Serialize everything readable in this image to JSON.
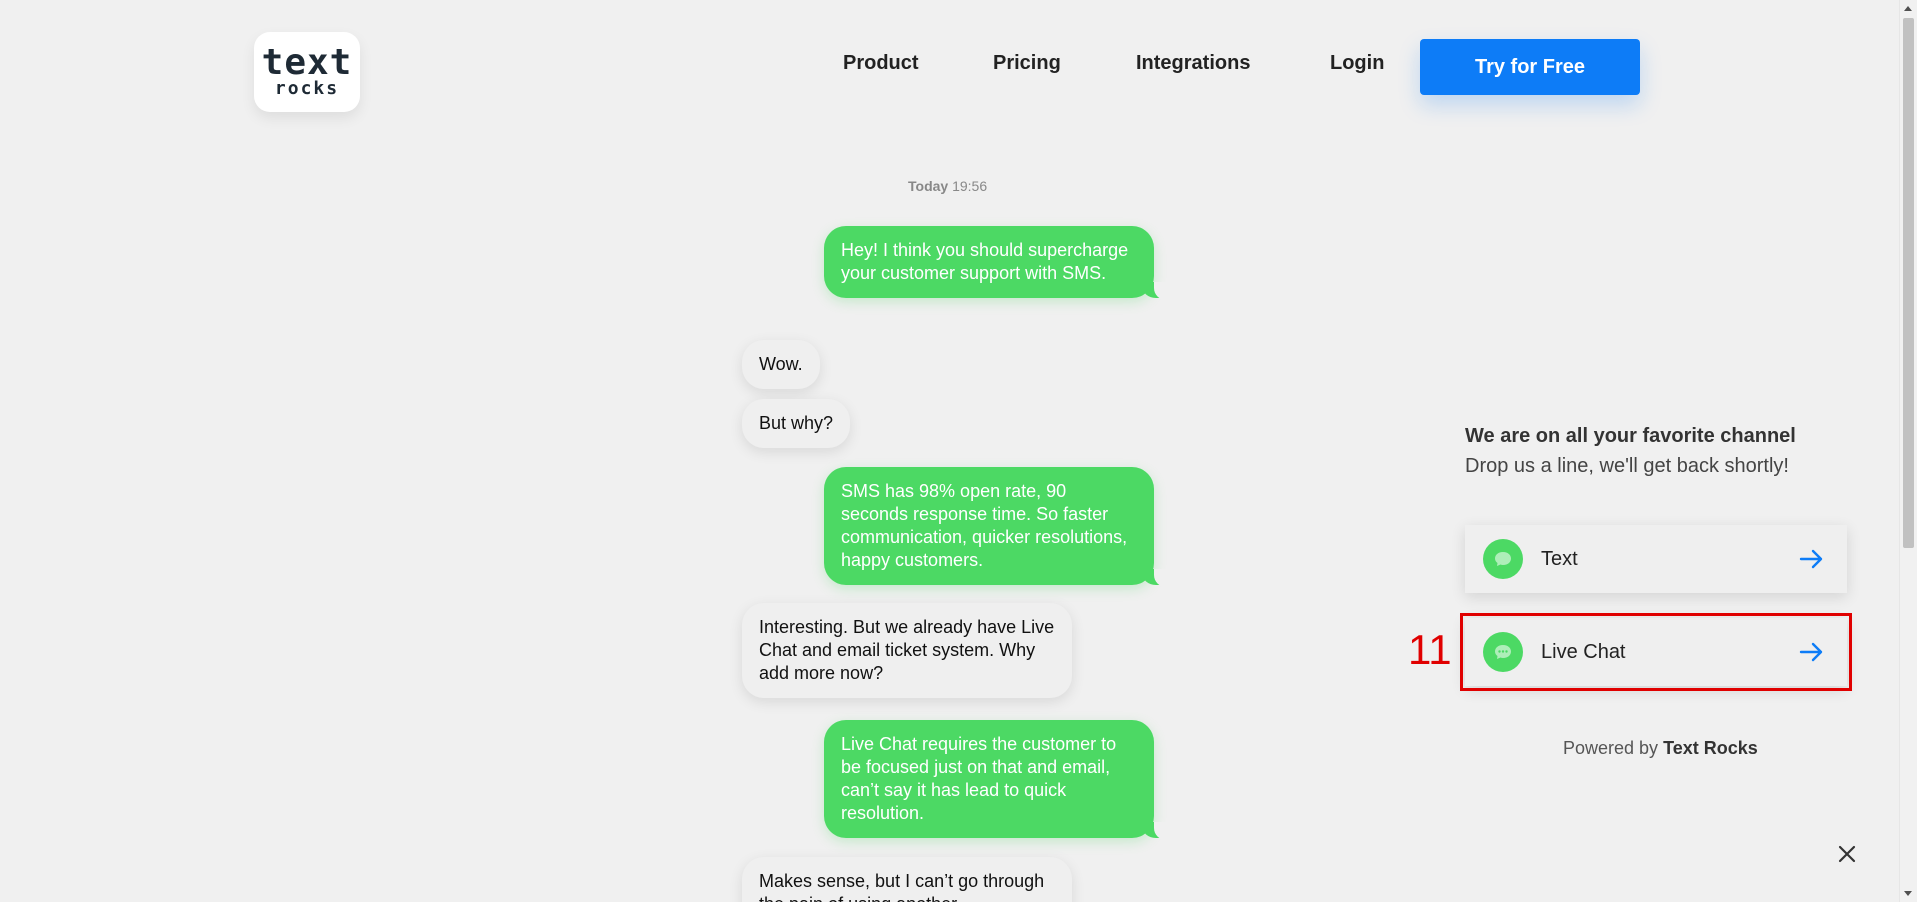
{
  "logo": {
    "main": "text",
    "sub": "rocks"
  },
  "nav": {
    "product": "Product",
    "pricing": "Pricing",
    "integrations": "Integrations",
    "login": "Login",
    "cta": "Try for Free"
  },
  "chat": {
    "timestamp_day": "Today",
    "timestamp_time": "19:56",
    "messages": [
      {
        "direction": "out",
        "text": "Hey! I think you should supercharge your customer support with SMS."
      },
      {
        "direction": "in",
        "text": "Wow."
      },
      {
        "direction": "in",
        "text": "But why?"
      },
      {
        "direction": "out",
        "text": "SMS has 98% open rate, 90 seconds response time. So faster communication, quicker resolutions, happy customers."
      },
      {
        "direction": "in",
        "text": "Interesting. But we already have Live Chat and email ticket system. Why add more now?"
      },
      {
        "direction": "out",
        "text": "Live Chat requires the customer to be focused just on that and email, can’t say it has lead to quick resolution."
      },
      {
        "direction": "in",
        "text": "Makes sense, but I can’t go through the pain of using another"
      }
    ]
  },
  "widget": {
    "heading": "We are on all your favorite channel",
    "subheading": "Drop us a line, we'll get back shortly!",
    "channels": [
      {
        "label": "Text",
        "icon": "chat-bubble-icon"
      },
      {
        "label": "Live Chat",
        "icon": "chat-dots-icon"
      }
    ],
    "annotation_number": "11",
    "powered_prefix": "Powered by",
    "powered_brand": "Text Rocks"
  },
  "colors": {
    "accent": "#0d7cf7",
    "bubble_green": "#4cd964",
    "highlight": "#e00000",
    "background": "#f0f0f0"
  }
}
